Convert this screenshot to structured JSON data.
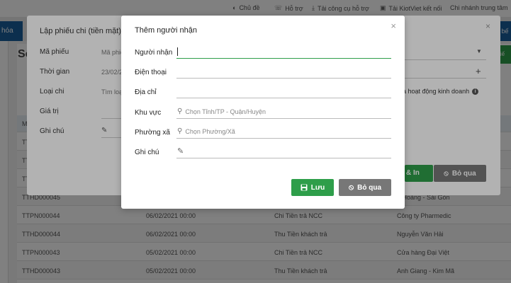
{
  "topbar": {
    "theme": "Chủ đề",
    "support": "Hỗ trợ",
    "support_tools": "Tải công cụ hỗ trợ",
    "kiotviet": "Tải KiotViet kết nối",
    "branch": "Chi nhánh trung tâm"
  },
  "nav": {
    "left_label": "hóa",
    "right_label": "à bế"
  },
  "page": {
    "heading_letter": "Sổ",
    "right_button": "phiế"
  },
  "table": {
    "head_first": "M",
    "rows": [
      {
        "code": "TTH",
        "date": "",
        "type": "",
        "partner": ""
      },
      {
        "code": "TTP",
        "date": "",
        "type": "",
        "partner": ""
      },
      {
        "code": "TTH",
        "date": "",
        "type": "",
        "partner": ""
      },
      {
        "code": "TTHD000045",
        "date": "",
        "type": "",
        "partner": "n Hoàng - Sài Gòn"
      },
      {
        "code": "TTPN000044",
        "date": "06/02/2021 00:00",
        "type": "Chi Tiền trả NCC",
        "partner": "Công ty Pharmedic"
      },
      {
        "code": "TTHD000044",
        "date": "06/02/2021 00:00",
        "type": "Thu Tiền khách trả",
        "partner": "Nguyễn Văn Hải"
      },
      {
        "code": "TTPN000043",
        "date": "05/02/2021 00:00",
        "type": "Chi Tiền trả NCC",
        "partner": "Cửa hàng Đại Việt"
      },
      {
        "code": "TTHD000043",
        "date": "05/02/2021 00:00",
        "type": "Thu Tiền khách trả",
        "partner": "Anh Giang - Kim Mã"
      }
    ]
  },
  "back_dialog": {
    "title": "Lập phiếu chi (tiền mặt)",
    "close": "×",
    "fields": [
      {
        "label": "Mã phiếu",
        "value": "Mã phiếu"
      },
      {
        "label": "Thời gian",
        "value": "23/02/2"
      },
      {
        "label": "Loại chi",
        "value": "Tìm loạ"
      },
      {
        "label": "Giá trị",
        "value": ""
      },
      {
        "label": "Ghi chú",
        "value": ""
      }
    ],
    "right_text": "à hoạt động kinh doanh",
    "info_glyph": "i",
    "plus_glyph": "+",
    "save_partial": "& In",
    "skip_label": "Bỏ qua"
  },
  "dialog": {
    "title": "Thêm người nhận",
    "close": "×",
    "fields": {
      "recipient": {
        "label": "Người nhận",
        "value": ""
      },
      "phone": {
        "label": "Điện thoại",
        "value": ""
      },
      "address": {
        "label": "Địa chỉ",
        "value": ""
      },
      "area": {
        "label": "Khu vực",
        "placeholder": "Chọn Tỉnh/TP - Quận/Huyện"
      },
      "ward": {
        "label": "Phường xã",
        "placeholder": "Chọn Phường/Xã"
      },
      "note": {
        "label": "Ghi chú",
        "value": ""
      }
    },
    "save_label": "Lưu",
    "skip_label": "Bỏ qua"
  },
  "colors": {
    "accent_green": "#2e9e4a",
    "neutral_button": "#777777",
    "nav_blue": "#1a5f9c"
  }
}
